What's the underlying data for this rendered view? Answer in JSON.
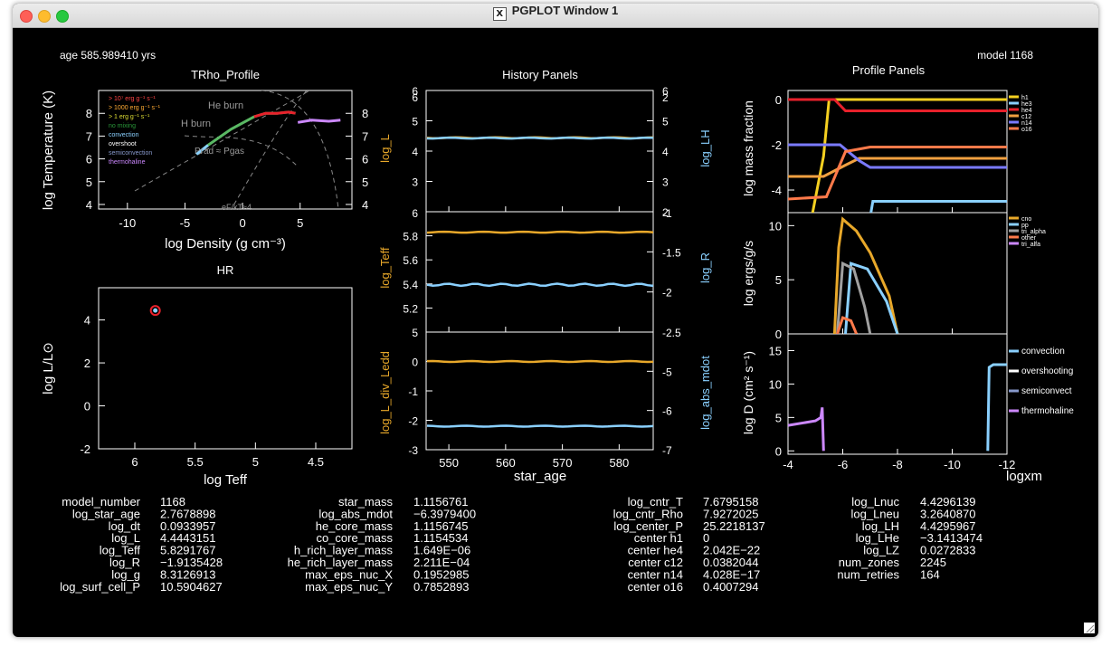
{
  "window": {
    "title": "PGPLOT Window 1",
    "x_icon": "X"
  },
  "header": {
    "age": "age 585.989410 yrs",
    "model": "model 1168"
  },
  "panels": {
    "trho": {
      "title": "TRho_Profile",
      "xlabel": "log Density (g cm⁻³)",
      "ylabel": "log Temperature (K)",
      "xticks": [
        "-10",
        "-5",
        "0",
        "5"
      ],
      "yticks": [
        "4",
        "5",
        "6",
        "7",
        "8"
      ],
      "yticks_right": [
        "4",
        "5",
        "6",
        "7",
        "8"
      ],
      "legend": [
        "> 10⁷ erg g⁻¹ s⁻¹",
        "> 1000 erg g⁻¹ s⁻¹",
        "> 1 erg g⁻¹ s⁻¹",
        "no mixing",
        "convection",
        "overshoot",
        "semiconvection",
        "thermohaline"
      ],
      "legend_colors": [
        "#ff4444",
        "#ffaa33",
        "#dddd33",
        "#2a9a3a",
        "#8ad0ff",
        "#ffffff",
        "#8899cc",
        "#cc88ff"
      ],
      "annotations": [
        "He burn",
        "H burn",
        "Prad ≈ Pgas",
        "eF/kT≈4"
      ]
    },
    "hr": {
      "title": "HR",
      "xlabel": "log Teff",
      "ylabel": "log L/L⊙",
      "xticks": [
        "6",
        "5.5",
        "5",
        "4.5"
      ],
      "yticks": [
        "-2",
        "0",
        "2",
        "4"
      ]
    },
    "history": {
      "title": "History Panels",
      "xlabel": "star_age",
      "xticks": [
        "550",
        "560",
        "570",
        "580"
      ],
      "p1": {
        "left_label": "log_L",
        "right_label": "log_LH",
        "yticks_left": [
          "3",
          "4",
          "5",
          "6"
        ],
        "yticks_right": [
          "2",
          "3",
          "4",
          "5",
          "6"
        ],
        "extra_left": "6",
        "extra_right": "2"
      },
      "p2": {
        "left_label": "log_Teff",
        "right_label": "log_R",
        "yticks_left": [
          "5.2",
          "5.4",
          "5.6",
          "5.8"
        ],
        "yticks_right": [
          "-2",
          "-1.5"
        ],
        "top_left": "6",
        "top_right": "-1",
        "bottom_left": "5",
        "bottom_right": "-2.5"
      },
      "p3": {
        "left_label": "log_L_div_Ledd",
        "right_label": "log_abs_mdot",
        "yticks_left": [
          "-3",
          "-2",
          "-1",
          "0"
        ],
        "yticks_right": [
          "-7",
          "-6",
          "-5"
        ]
      }
    },
    "profile": {
      "title": "Profile Panels",
      "xlabel": "logxm",
      "xticks": [
        "-4",
        "-6",
        "-8",
        "-10",
        "-12"
      ],
      "p1": {
        "ylabel": "log mass fraction",
        "yticks": [
          "-4",
          "-2",
          "0"
        ],
        "legend": [
          "h1",
          "he3",
          "he4",
          "c12",
          "n14",
          "o16"
        ],
        "legend_colors": [
          "#f5d020",
          "#8ad0ff",
          "#e8212b",
          "#f0a040",
          "#7a7aff",
          "#ff7a4a"
        ]
      },
      "p2": {
        "ylabel": "log ergs/g/s",
        "yticks": [
          "0",
          "5",
          "10"
        ],
        "legend": [
          "cno",
          "pp",
          "tri_alpha",
          "other",
          "tri_alfa"
        ],
        "legend_colors": [
          "#e8a82a",
          "#8ad0ff",
          "#a0a0a0",
          "#ff7a4a",
          "#cc88ff"
        ]
      },
      "p3": {
        "ylabel": "log D (cm² s⁻¹)",
        "yticks": [
          "0",
          "5",
          "10",
          "15"
        ],
        "legend": [
          "convection",
          "overshooting",
          "semiconvect",
          "thermohaline"
        ],
        "legend_colors": [
          "#8ad0ff",
          "#ffffff",
          "#8899cc",
          "#cc88ff"
        ]
      }
    }
  },
  "stats": {
    "col1": [
      {
        "name": "model_number",
        "value": "1168"
      },
      {
        "name": "log_star_age",
        "value": "2.7678898"
      },
      {
        "name": "log_dt",
        "value": "0.0933957"
      },
      {
        "name": "log_L",
        "value": "4.4443151"
      },
      {
        "name": "log_Teff",
        "value": "5.8291767"
      },
      {
        "name": "log_R",
        "value": "−1.9135428"
      },
      {
        "name": "log_g",
        "value": "8.3126913"
      },
      {
        "name": "log_surf_cell_P",
        "value": "10.5904627"
      }
    ],
    "col2": [
      {
        "name": "star_mass",
        "value": "1.1156761"
      },
      {
        "name": "log_abs_mdot",
        "value": "−6.3979400"
      },
      {
        "name": "he_core_mass",
        "value": "1.1156745"
      },
      {
        "name": "co_core_mass",
        "value": "1.1154534"
      },
      {
        "name": "h_rich_layer_mass",
        "value": "1.649E−06"
      },
      {
        "name": "he_rich_layer_mass",
        "value": "2.211E−04"
      },
      {
        "name": "max_eps_nuc_X",
        "value": "0.1952985"
      },
      {
        "name": "max_eps_nuc_Y",
        "value": "0.7852893"
      }
    ],
    "col3": [
      {
        "name": "log_cntr_T",
        "value": "7.6795158"
      },
      {
        "name": "log_cntr_Rho",
        "value": "7.9272025"
      },
      {
        "name": "log_center_P",
        "value": "25.2218137"
      },
      {
        "name": "center h1",
        "value": "0"
      },
      {
        "name": "center he4",
        "value": "2.042E−22"
      },
      {
        "name": "center c12",
        "value": "0.0382044"
      },
      {
        "name": "center n14",
        "value": "4.028E−17"
      },
      {
        "name": "center o16",
        "value": "0.4007294"
      }
    ],
    "col4": [
      {
        "name": "log_Lnuc",
        "value": "4.4296139"
      },
      {
        "name": "log_Lneu",
        "value": "3.2640870"
      },
      {
        "name": "log_LH",
        "value": "4.4295967"
      },
      {
        "name": "log_LHe",
        "value": "−3.1413474"
      },
      {
        "name": "log_LZ",
        "value": "0.0272833"
      },
      {
        "name": "num_zones",
        "value": "2245"
      },
      {
        "name": "num_retries",
        "value": "164"
      }
    ]
  },
  "chart_data": [
    {
      "type": "line",
      "title": "TRho_Profile",
      "xlabel": "log Density (g cm⁻³)",
      "ylabel": "log Temperature (K)",
      "xlim": [
        -12.5,
        9.5
      ],
      "ylim": [
        3.8,
        9.0
      ],
      "series": [
        {
          "values": [
            [
              -4,
              6.2
            ],
            [
              -3,
              6.6
            ],
            [
              -1,
              7.3
            ],
            [
              1,
              7.85
            ],
            [
              2,
              8.0
            ],
            [
              3,
              8.0
            ],
            [
              4,
              8.05
            ],
            [
              4.6,
              8.0
            ],
            [
              4.8,
              7.6
            ],
            [
              6,
              7.7
            ],
            [
              7.5,
              7.65
            ],
            [
              8.5,
              7.7
            ]
          ]
        }
      ]
    },
    {
      "type": "scatter",
      "title": "HR",
      "xlabel": "log Teff",
      "ylabel": "log L/L⊙",
      "xlim": [
        6.3,
        4.2
      ],
      "ylim": [
        -2,
        5.5
      ],
      "series": [
        {
          "values": [
            [
              5.83,
              4.44
            ]
          ]
        }
      ]
    },
    {
      "type": "line",
      "title": "History Panels",
      "xlabel": "star_age",
      "xlim": [
        546,
        586
      ],
      "series": [
        {
          "name": "log_L",
          "axis": "left",
          "ylim": [
            2,
            6
          ],
          "y": 4.44
        },
        {
          "name": "log_LH",
          "axis": "right",
          "ylim": [
            2,
            6
          ],
          "y": 4.43
        },
        {
          "name": "log_Teff",
          "axis": "left",
          "ylim": [
            5,
            6
          ],
          "y": 5.83
        },
        {
          "name": "log_R",
          "axis": "right",
          "ylim": [
            -2.5,
            -1
          ],
          "y": -1.91
        },
        {
          "name": "log_L_div_Ledd",
          "axis": "left",
          "ylim": [
            -3,
            1
          ],
          "y": 0.0
        },
        {
          "name": "log_abs_mdot",
          "axis": "right",
          "ylim": [
            -7,
            -4
          ],
          "y": -6.4
        }
      ]
    },
    {
      "type": "line",
      "title": "Profile Panels",
      "xlabel": "logxm",
      "xlim": [
        -4,
        -12
      ],
      "p1_ylim": [
        -5,
        0.4
      ],
      "p2_ylim": [
        0,
        11.2
      ],
      "p3_ylim": [
        -0.5,
        17.5
      ],
      "p1_series": [
        {
          "name": "h1",
          "values": [
            [
              -4.9,
              -5
            ],
            [
              -5.3,
              -2.5
            ],
            [
              -5.5,
              0
            ],
            [
              -12,
              0
            ]
          ]
        },
        {
          "name": "he4",
          "values": [
            [
              -4,
              0
            ],
            [
              -5.7,
              0
            ],
            [
              -6.1,
              -0.5
            ],
            [
              -12,
              -0.5
            ]
          ]
        },
        {
          "name": "c12",
          "values": [
            [
              -4,
              -3.4
            ],
            [
              -5.3,
              -3.4
            ],
            [
              -6.1,
              -2.9
            ],
            [
              -6.6,
              -2.6
            ],
            [
              -12,
              -2.6
            ]
          ]
        },
        {
          "name": "n14",
          "values": [
            [
              -4,
              -2
            ],
            [
              -5.9,
              -2
            ],
            [
              -6.6,
              -2.7
            ],
            [
              -7,
              -3
            ],
            [
              -12,
              -3
            ]
          ]
        },
        {
          "name": "o16",
          "values": [
            [
              -4,
              -4.4
            ],
            [
              -5.4,
              -4.3
            ],
            [
              -6.1,
              -2.3
            ],
            [
              -7,
              -2.1
            ],
            [
              -12,
              -2.1
            ]
          ]
        },
        {
          "name": "he3",
          "values": [
            [
              -7,
              -5.2
            ],
            [
              -7.1,
              -4.5
            ],
            [
              -12,
              -4.5
            ]
          ]
        }
      ],
      "p2_series": [
        {
          "name": "cno",
          "values": [
            [
              -5.7,
              0
            ],
            [
              -5.85,
              8
            ],
            [
              -6.0,
              10.6
            ],
            [
              -6.5,
              9.5
            ],
            [
              -7,
              7.5
            ],
            [
              -7.7,
              3.5
            ],
            [
              -8,
              0
            ]
          ]
        },
        {
          "name": "pp",
          "values": [
            [
              -6.1,
              0
            ],
            [
              -6.3,
              6.5
            ],
            [
              -6.9,
              6
            ],
            [
              -7.6,
              3
            ],
            [
              -8,
              0
            ]
          ]
        },
        {
          "name": "tri_alpha",
          "values": [
            [
              -5.8,
              0
            ],
            [
              -6.0,
              6.5
            ],
            [
              -6.4,
              6
            ],
            [
              -6.8,
              2.5
            ],
            [
              -7,
              0
            ]
          ]
        },
        {
          "name": "other",
          "values": [
            [
              -5.8,
              0
            ],
            [
              -6,
              1.5
            ],
            [
              -6.3,
              1.2
            ],
            [
              -6.5,
              0
            ]
          ]
        }
      ],
      "p3_series": [
        {
          "name": "convection",
          "values": [
            [
              -11.3,
              0
            ],
            [
              -11.35,
              12.5
            ],
            [
              -11.5,
              12.9
            ],
            [
              -12,
              12.9
            ]
          ]
        },
        {
          "name": "thermohaline",
          "values": [
            [
              -4,
              3.8
            ],
            [
              -5,
              4.5
            ],
            [
              -5.2,
              5
            ],
            [
              -5.25,
              6.5
            ],
            [
              -5.3,
              0
            ]
          ]
        }
      ]
    }
  ]
}
